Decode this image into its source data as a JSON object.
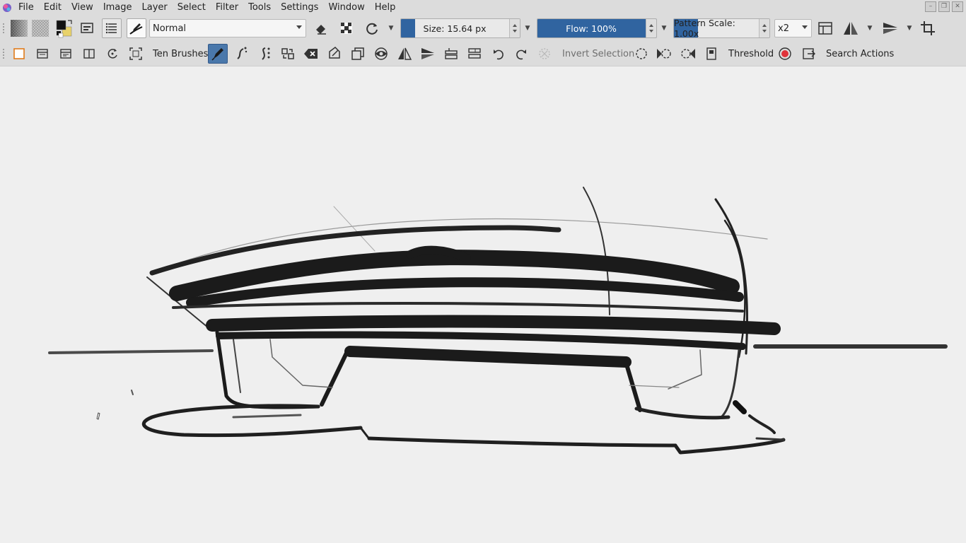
{
  "menubar": {
    "items": [
      "File",
      "Edit",
      "View",
      "Image",
      "Layer",
      "Select",
      "Filter",
      "Tools",
      "Settings",
      "Window",
      "Help"
    ],
    "window_controls": [
      "minimize-icon",
      "restore-icon",
      "close-icon"
    ]
  },
  "toolbar1": {
    "blend_mode": "Normal",
    "size_label": "Size: 15.64 px",
    "size_fraction": 0.12,
    "flow_label": "Flow: 100%",
    "flow_fraction": 1.0,
    "pattern_scale_label": "Pattern Scale: 1.00x",
    "pattern_scale_fraction": 0.25,
    "zoom_combo": "x2",
    "colors": {
      "foreground": "#111111",
      "background": "#e8d26a",
      "accent": "#3064a0"
    }
  },
  "toolbar2": {
    "brushes_label": "Ten Brushes",
    "invert_selection_label": "Invert Selection",
    "threshold_label": "Threshold",
    "search_actions_label": "Search Actions"
  }
}
